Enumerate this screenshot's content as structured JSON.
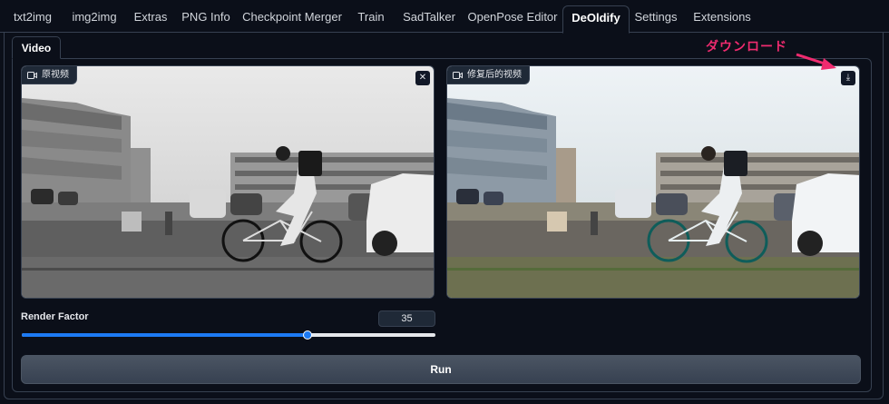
{
  "nav": {
    "tabs": [
      {
        "label": "txt2img"
      },
      {
        "label": "img2img"
      },
      {
        "label": "Extras"
      },
      {
        "label": "PNG Info"
      },
      {
        "label": "Checkpoint Merger"
      },
      {
        "label": "Train"
      },
      {
        "label": "SadTalker"
      },
      {
        "label": "OpenPose Editor"
      },
      {
        "label": "DeOldify"
      },
      {
        "label": "Settings"
      },
      {
        "label": "Extensions"
      }
    ],
    "active": "DeOldify"
  },
  "subtabs": {
    "video": "Video"
  },
  "input_video": {
    "label": "原视频",
    "icon": "video-icon",
    "close_icon": "close-icon",
    "close_glyph": "✕"
  },
  "output_video": {
    "label": "修复后的视频",
    "icon": "video-icon",
    "download_icon": "download-icon",
    "download_glyph": "⤓"
  },
  "annotation": {
    "text": "ダウンロード",
    "color": "#ef2b6f"
  },
  "render_factor": {
    "label": "Render Factor",
    "value": "35",
    "min": 1,
    "max": 50,
    "fraction": 0.69
  },
  "run_button": {
    "label": "Run"
  },
  "colors": {
    "background": "#0b0f19",
    "border": "#374151",
    "accent": "#1d7af3",
    "button": "#4b5563"
  }
}
